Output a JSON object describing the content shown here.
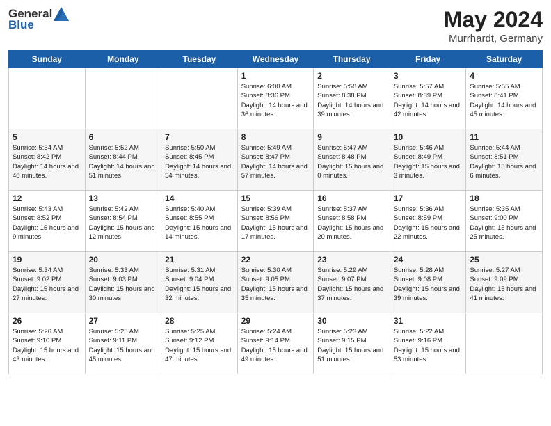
{
  "logo": {
    "general": "General",
    "blue": "Blue"
  },
  "title": {
    "month_year": "May 2024",
    "location": "Murrhardt, Germany"
  },
  "days_of_week": [
    "Sunday",
    "Monday",
    "Tuesday",
    "Wednesday",
    "Thursday",
    "Friday",
    "Saturday"
  ],
  "weeks": [
    [
      {
        "day": "",
        "sunrise": "",
        "sunset": "",
        "daylight": ""
      },
      {
        "day": "",
        "sunrise": "",
        "sunset": "",
        "daylight": ""
      },
      {
        "day": "",
        "sunrise": "",
        "sunset": "",
        "daylight": ""
      },
      {
        "day": "1",
        "sunrise": "Sunrise: 6:00 AM",
        "sunset": "Sunset: 8:36 PM",
        "daylight": "Daylight: 14 hours and 36 minutes."
      },
      {
        "day": "2",
        "sunrise": "Sunrise: 5:58 AM",
        "sunset": "Sunset: 8:38 PM",
        "daylight": "Daylight: 14 hours and 39 minutes."
      },
      {
        "day": "3",
        "sunrise": "Sunrise: 5:57 AM",
        "sunset": "Sunset: 8:39 PM",
        "daylight": "Daylight: 14 hours and 42 minutes."
      },
      {
        "day": "4",
        "sunrise": "Sunrise: 5:55 AM",
        "sunset": "Sunset: 8:41 PM",
        "daylight": "Daylight: 14 hours and 45 minutes."
      }
    ],
    [
      {
        "day": "5",
        "sunrise": "Sunrise: 5:54 AM",
        "sunset": "Sunset: 8:42 PM",
        "daylight": "Daylight: 14 hours and 48 minutes."
      },
      {
        "day": "6",
        "sunrise": "Sunrise: 5:52 AM",
        "sunset": "Sunset: 8:44 PM",
        "daylight": "Daylight: 14 hours and 51 minutes."
      },
      {
        "day": "7",
        "sunrise": "Sunrise: 5:50 AM",
        "sunset": "Sunset: 8:45 PM",
        "daylight": "Daylight: 14 hours and 54 minutes."
      },
      {
        "day": "8",
        "sunrise": "Sunrise: 5:49 AM",
        "sunset": "Sunset: 8:47 PM",
        "daylight": "Daylight: 14 hours and 57 minutes."
      },
      {
        "day": "9",
        "sunrise": "Sunrise: 5:47 AM",
        "sunset": "Sunset: 8:48 PM",
        "daylight": "Daylight: 15 hours and 0 minutes."
      },
      {
        "day": "10",
        "sunrise": "Sunrise: 5:46 AM",
        "sunset": "Sunset: 8:49 PM",
        "daylight": "Daylight: 15 hours and 3 minutes."
      },
      {
        "day": "11",
        "sunrise": "Sunrise: 5:44 AM",
        "sunset": "Sunset: 8:51 PM",
        "daylight": "Daylight: 15 hours and 6 minutes."
      }
    ],
    [
      {
        "day": "12",
        "sunrise": "Sunrise: 5:43 AM",
        "sunset": "Sunset: 8:52 PM",
        "daylight": "Daylight: 15 hours and 9 minutes."
      },
      {
        "day": "13",
        "sunrise": "Sunrise: 5:42 AM",
        "sunset": "Sunset: 8:54 PM",
        "daylight": "Daylight: 15 hours and 12 minutes."
      },
      {
        "day": "14",
        "sunrise": "Sunrise: 5:40 AM",
        "sunset": "Sunset: 8:55 PM",
        "daylight": "Daylight: 15 hours and 14 minutes."
      },
      {
        "day": "15",
        "sunrise": "Sunrise: 5:39 AM",
        "sunset": "Sunset: 8:56 PM",
        "daylight": "Daylight: 15 hours and 17 minutes."
      },
      {
        "day": "16",
        "sunrise": "Sunrise: 5:37 AM",
        "sunset": "Sunset: 8:58 PM",
        "daylight": "Daylight: 15 hours and 20 minutes."
      },
      {
        "day": "17",
        "sunrise": "Sunrise: 5:36 AM",
        "sunset": "Sunset: 8:59 PM",
        "daylight": "Daylight: 15 hours and 22 minutes."
      },
      {
        "day": "18",
        "sunrise": "Sunrise: 5:35 AM",
        "sunset": "Sunset: 9:00 PM",
        "daylight": "Daylight: 15 hours and 25 minutes."
      }
    ],
    [
      {
        "day": "19",
        "sunrise": "Sunrise: 5:34 AM",
        "sunset": "Sunset: 9:02 PM",
        "daylight": "Daylight: 15 hours and 27 minutes."
      },
      {
        "day": "20",
        "sunrise": "Sunrise: 5:33 AM",
        "sunset": "Sunset: 9:03 PM",
        "daylight": "Daylight: 15 hours and 30 minutes."
      },
      {
        "day": "21",
        "sunrise": "Sunrise: 5:31 AM",
        "sunset": "Sunset: 9:04 PM",
        "daylight": "Daylight: 15 hours and 32 minutes."
      },
      {
        "day": "22",
        "sunrise": "Sunrise: 5:30 AM",
        "sunset": "Sunset: 9:05 PM",
        "daylight": "Daylight: 15 hours and 35 minutes."
      },
      {
        "day": "23",
        "sunrise": "Sunrise: 5:29 AM",
        "sunset": "Sunset: 9:07 PM",
        "daylight": "Daylight: 15 hours and 37 minutes."
      },
      {
        "day": "24",
        "sunrise": "Sunrise: 5:28 AM",
        "sunset": "Sunset: 9:08 PM",
        "daylight": "Daylight: 15 hours and 39 minutes."
      },
      {
        "day": "25",
        "sunrise": "Sunrise: 5:27 AM",
        "sunset": "Sunset: 9:09 PM",
        "daylight": "Daylight: 15 hours and 41 minutes."
      }
    ],
    [
      {
        "day": "26",
        "sunrise": "Sunrise: 5:26 AM",
        "sunset": "Sunset: 9:10 PM",
        "daylight": "Daylight: 15 hours and 43 minutes."
      },
      {
        "day": "27",
        "sunrise": "Sunrise: 5:25 AM",
        "sunset": "Sunset: 9:11 PM",
        "daylight": "Daylight: 15 hours and 45 minutes."
      },
      {
        "day": "28",
        "sunrise": "Sunrise: 5:25 AM",
        "sunset": "Sunset: 9:12 PM",
        "daylight": "Daylight: 15 hours and 47 minutes."
      },
      {
        "day": "29",
        "sunrise": "Sunrise: 5:24 AM",
        "sunset": "Sunset: 9:14 PM",
        "daylight": "Daylight: 15 hours and 49 minutes."
      },
      {
        "day": "30",
        "sunrise": "Sunrise: 5:23 AM",
        "sunset": "Sunset: 9:15 PM",
        "daylight": "Daylight: 15 hours and 51 minutes."
      },
      {
        "day": "31",
        "sunrise": "Sunrise: 5:22 AM",
        "sunset": "Sunset: 9:16 PM",
        "daylight": "Daylight: 15 hours and 53 minutes."
      },
      {
        "day": "",
        "sunrise": "",
        "sunset": "",
        "daylight": ""
      }
    ]
  ]
}
